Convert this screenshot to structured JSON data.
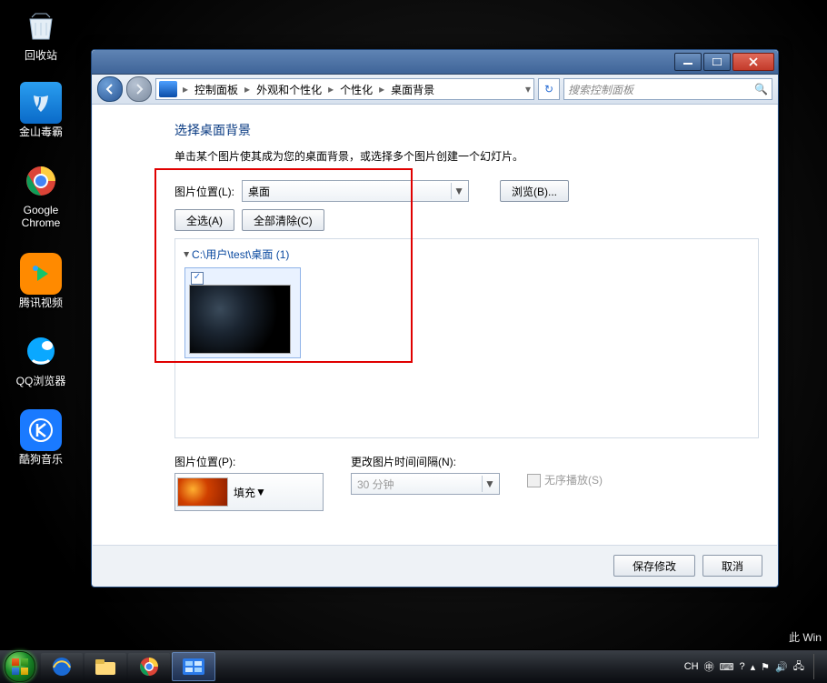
{
  "desktop_icons": [
    {
      "label": "回收站",
      "kind": "recycle"
    },
    {
      "label": "金山毒霸",
      "kind": "duba"
    },
    {
      "label": "Google\nChrome",
      "kind": "chrome"
    },
    {
      "label": "腾讯视频",
      "kind": "tencent"
    },
    {
      "label": "QQ浏览器",
      "kind": "qqb"
    },
    {
      "label": "酷狗音乐",
      "kind": "kugou"
    }
  ],
  "window": {
    "breadcrumb": [
      "控制面板",
      "外观和个性化",
      "个性化",
      "桌面背景"
    ],
    "search_placeholder": "搜索控制面板",
    "title": "选择桌面背景",
    "subtitle": "单击某个图片使其成为您的桌面背景，或选择多个图片创建一个幻灯片。",
    "loc_label": "图片位置(L):",
    "loc_value": "桌面",
    "browse": "浏览(B)...",
    "select_all": "全选(A)",
    "clear_all": "全部清除(C)",
    "gallery_path": "C:\\用户\\test\\桌面 (1)",
    "pos_label": "图片位置(P):",
    "pos_value": "填充",
    "interval_label": "更改图片时间间隔(N):",
    "interval_value": "30 分钟",
    "shuffle": "无序播放(S)",
    "save": "保存修改",
    "cancel": "取消"
  },
  "tray": {
    "ime": "CH",
    "note": "此 Win"
  },
  "colors": {
    "link": "#0b4aa0"
  }
}
